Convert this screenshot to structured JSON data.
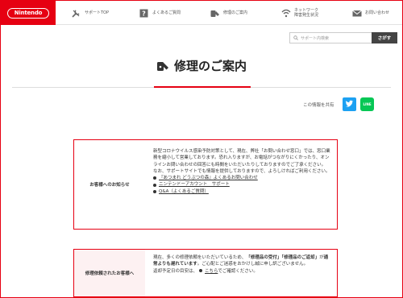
{
  "header": {
    "logo_text": "Nintendo",
    "nav": [
      {
        "label": "サポートTOP",
        "icon": "wrench-icon"
      },
      {
        "label": "よくあるご質問",
        "icon": "question-icon"
      },
      {
        "label": "修理のご案内",
        "icon": "repair-icon"
      },
      {
        "label_line1": "ネットワーク",
        "label_line2": "障害発生状況",
        "icon": "wifi-icon"
      },
      {
        "label": "お問い合わせ",
        "icon": "mail-icon"
      }
    ]
  },
  "search": {
    "placeholder": "サポート内検索",
    "button_label": "さがす"
  },
  "page": {
    "title": "修理のご案内",
    "share_label": "この情報を共有",
    "line_label": "LINE"
  },
  "notice1": {
    "heading": "お客様へのお知らせ",
    "paragraph1": "新型コロナウイルス感染予防対策として、現在、弊社「お問い合わせ窓口」では、窓口業務を縮小して営業しております。恐れ入りますが、お電話がつながりにくかったり、オンラインお問い合わせの回答にも時間をいただいたりしておりますのでご了承ください。",
    "paragraph2": "なお、サポートサイトでも情報を提供しておりますので、よろしければご利用ください。",
    "links": [
      "『あつまれ どうぶつの森』よくあるお問い合わせ",
      "ニンテンドーアカウント　サポート",
      "Q&A（よくあるご質問）"
    ]
  },
  "notice2": {
    "heading": "修理依頼されたお客様へ",
    "text_a": "現在、多くの修理依頼をいただいているため、",
    "text_bold1": "「修理品の受付」「修理品のご返却」",
    "text_b": "が",
    "text_bold2": "通常よりも遅れています",
    "text_c": "。ご心配とご迷惑をおかけし誠に申し訳ございません。",
    "text_d": "返却予定日の目安は、",
    "link": "こちら",
    "text_e": "でご確認ください。"
  },
  "colors": {
    "brand_red": "#e60012",
    "twitter": "#1da1f2",
    "line": "#06c755",
    "notice_bg": "#fdf1f2"
  }
}
